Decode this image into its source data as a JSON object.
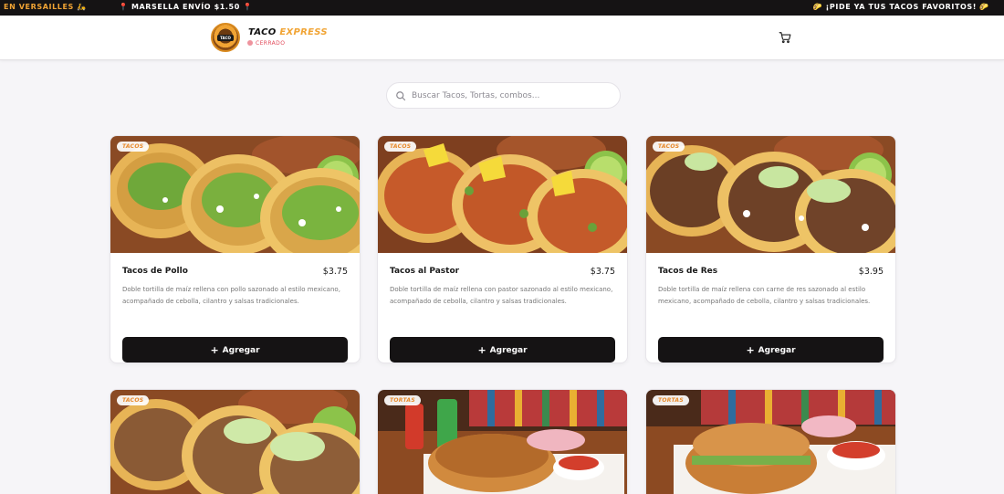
{
  "ticker": {
    "item1": "EN VERSAILLES 🛵",
    "item2": "📍 MARSELLA ENVÍO $1.50 📍",
    "item3": "🌮 ¡PIDE YA TUS TACOS FAVORITOS! 🌮"
  },
  "header": {
    "logo_text": "TACO EXPRESS",
    "brand_part1": "TACO",
    "brand_part2": "EXPRESS",
    "status": "CERRADO",
    "cart_icon": "cart-icon"
  },
  "search": {
    "placeholder": "Buscar Tacos, Tortas, combos..."
  },
  "colors": {
    "accent": "#f1a434",
    "closed": "#e24b5b",
    "button": "#151314"
  },
  "products": [
    {
      "tag": "TACOS",
      "name": "Tacos de Pollo",
      "price": "$3.75",
      "description": "Doble tortilla de maíz rellena con pollo sazonado al estilo mexicano, acompañado de cebolla, cilantro y salsas tradicionales.",
      "button": "Agregar"
    },
    {
      "tag": "TACOS",
      "name": "Tacos al Pastor",
      "price": "$3.75",
      "description": "Doble tortilla de maíz rellena con pastor sazonado al estilo mexicano, acompañado de cebolla, cilantro y salsas tradicionales.",
      "button": "Agregar"
    },
    {
      "tag": "TACOS",
      "name": "Tacos de Res",
      "price": "$3.95",
      "description": "Doble tortilla de maíz rellena con carne de res sazonado al estilo mexicano, acompañado de cebolla, cilantro y salsas tradicionales.",
      "button": "Agregar"
    },
    {
      "tag": "TACOS"
    },
    {
      "tag": "TORTAS"
    },
    {
      "tag": "TORTAS"
    }
  ]
}
